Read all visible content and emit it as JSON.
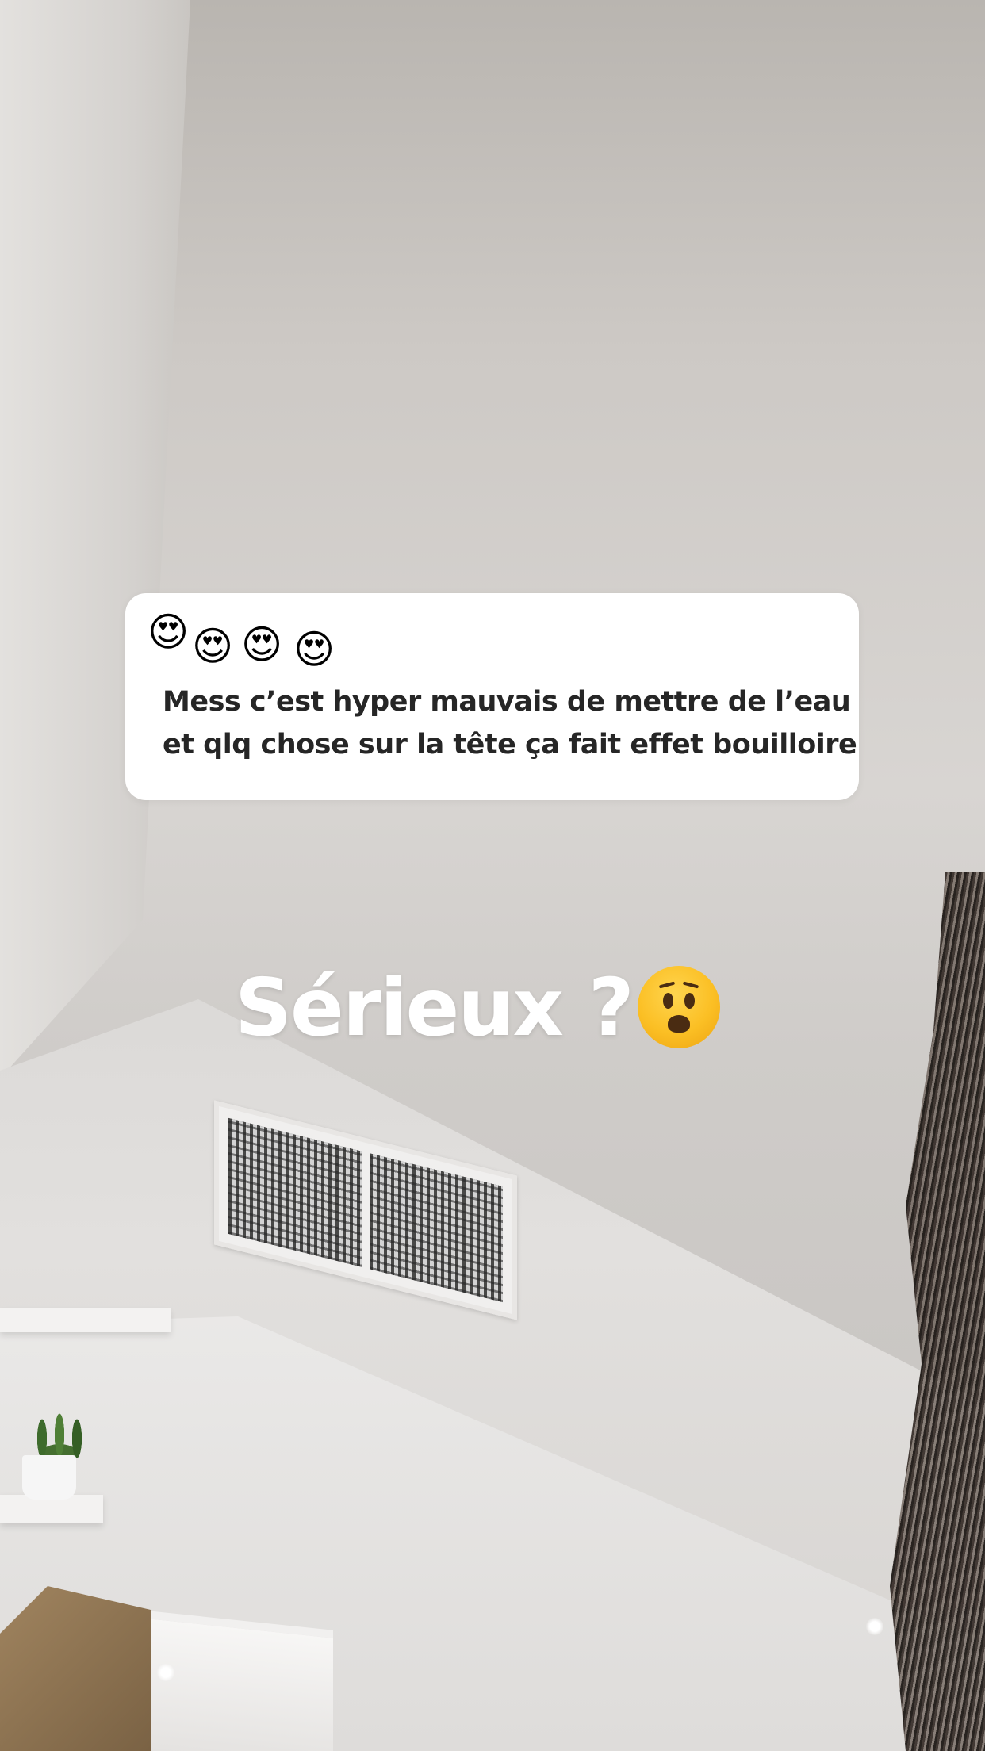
{
  "story": {
    "question": {
      "emojis": [
        "😍",
        "😍",
        "😍",
        "😍"
      ],
      "line1": "Mess c’est hyper mauvais de mettre de l’eau",
      "line2": "et qlq chose sur la tête ça fait effet bouilloire"
    },
    "caption": {
      "text": "Sérieux ?",
      "emoji_icon": "anguished-face-icon"
    }
  }
}
